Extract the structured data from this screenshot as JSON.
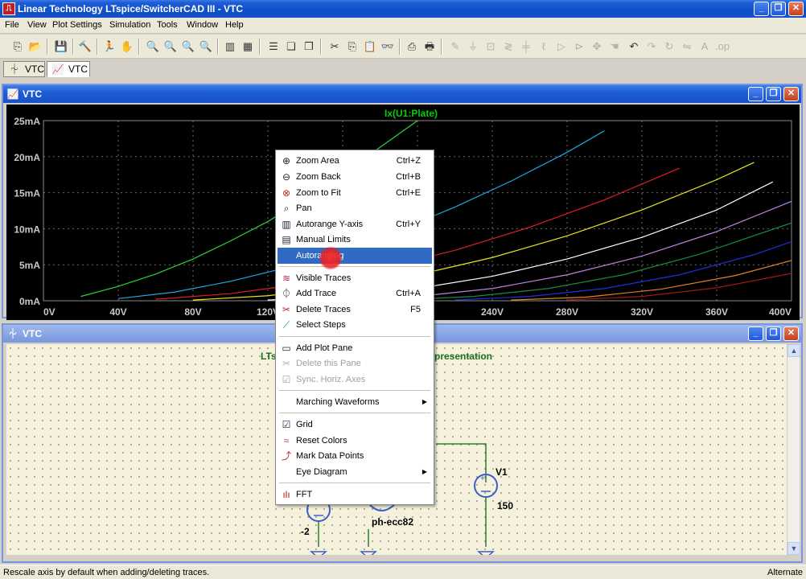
{
  "window": {
    "title": "Linear Technology LTspice/SwitcherCAD III - VTC",
    "app_icon": "ltspice-logo-icon"
  },
  "menubar": [
    "File",
    "View",
    "Plot Settings",
    "Simulation",
    "Tools",
    "Window",
    "Help"
  ],
  "tabs": [
    {
      "label": "VTC",
      "icon": "schematic-icon"
    },
    {
      "label": "VTC",
      "icon": "waveform-icon"
    }
  ],
  "plot_window": {
    "title": "VTC",
    "trace_title": "Ix(U1:Plate)"
  },
  "chart_data": {
    "type": "line",
    "title": "Ix(U1:Plate)",
    "xlabel": "",
    "ylabel": "",
    "x_ticks": [
      "0V",
      "40V",
      "80V",
      "120V",
      "160V",
      "200V",
      "240V",
      "280V",
      "320V",
      "360V",
      "400V"
    ],
    "y_ticks": [
      "0mA",
      "5mA",
      "10mA",
      "15mA",
      "20mA",
      "25mA"
    ],
    "xlim": [
      0,
      400
    ],
    "ylim": [
      0,
      25
    ],
    "grid": true,
    "background": "#000000",
    "series": [
      {
        "color": "#2cd23c",
        "x": [
          20,
          40,
          60,
          80,
          100,
          120,
          140,
          160,
          180,
          200,
          220
        ],
        "y": [
          0.6,
          2.0,
          3.7,
          5.8,
          8.3,
          11.0,
          14.2,
          17.6,
          21.3,
          25.0,
          28.0
        ]
      },
      {
        "color": "#1ea8e0",
        "x": [
          40,
          70,
          100,
          130,
          160,
          190,
          220,
          250,
          280,
          300
        ],
        "y": [
          0.3,
          1.2,
          2.7,
          4.6,
          7.0,
          9.8,
          13.0,
          16.6,
          20.6,
          23.6
        ]
      },
      {
        "color": "#e02020",
        "x": [
          60,
          100,
          140,
          180,
          220,
          260,
          300,
          340
        ],
        "y": [
          0.2,
          1.0,
          2.4,
          4.4,
          7.0,
          10.2,
          14.0,
          18.4
        ]
      },
      {
        "color": "#e6e620",
        "x": [
          80,
          120,
          160,
          200,
          240,
          280,
          320,
          360,
          380
        ],
        "y": [
          0.1,
          0.7,
          1.9,
          3.6,
          6.0,
          9.0,
          12.6,
          16.8,
          19.2
        ]
      },
      {
        "color": "#ffffff",
        "x": [
          120,
          160,
          200,
          240,
          280,
          320,
          360,
          390
        ],
        "y": [
          0.1,
          0.6,
          1.7,
          3.4,
          5.8,
          8.8,
          12.6,
          16.5
        ]
      },
      {
        "color": "#c080e0",
        "x": [
          160,
          200,
          240,
          280,
          320,
          360,
          400
        ],
        "y": [
          0.1,
          0.6,
          1.7,
          3.6,
          6.2,
          9.6,
          13.8
        ]
      },
      {
        "color": "#1c8a3c",
        "x": [
          190,
          230,
          270,
          310,
          350,
          400
        ],
        "y": [
          0.1,
          0.6,
          1.7,
          3.6,
          6.4,
          10.8
        ]
      },
      {
        "color": "#2030e0",
        "x": [
          220,
          260,
          300,
          340,
          380,
          400
        ],
        "y": [
          0.1,
          0.6,
          1.7,
          3.6,
          6.4,
          8.2
        ]
      },
      {
        "color": "#e08020",
        "x": [
          250,
          290,
          330,
          370,
          400
        ],
        "y": [
          0.1,
          0.5,
          1.6,
          3.5,
          5.6
        ]
      },
      {
        "color": "#a01818",
        "x": [
          280,
          320,
          360,
          400
        ],
        "y": [
          0.1,
          0.6,
          1.8,
          3.8
        ]
      }
    ]
  },
  "schematic_window": {
    "title": "VTC",
    "text_left": "LTs",
    "text_right": "presentation",
    "labels": {
      "v1": "V1",
      "v1_value": "150",
      "v2_value": "-2",
      "tube": "ph-ecc82"
    }
  },
  "context_menu": {
    "items": [
      {
        "label": "Zoom Area",
        "shortcut": "Ctrl+Z",
        "icon": "zoom-area-icon"
      },
      {
        "label": "Zoom Back",
        "shortcut": "Ctrl+B",
        "icon": "zoom-back-icon"
      },
      {
        "label": "Zoom to Fit",
        "shortcut": "Ctrl+E",
        "icon": "zoom-fit-icon"
      },
      {
        "label": "Pan",
        "shortcut": "",
        "icon": "pan-icon"
      },
      {
        "label": "Autorange Y-axis",
        "shortcut": "Ctrl+Y",
        "icon": "autorange-icon"
      },
      {
        "label": "Manual Limits",
        "shortcut": "",
        "icon": "manual-limits-icon"
      },
      {
        "label": "Autoranging",
        "shortcut": "",
        "icon": ""
      },
      {
        "label": "Visible Traces",
        "shortcut": "",
        "icon": "visible-traces-icon"
      },
      {
        "label": "Add Trace",
        "shortcut": "Ctrl+A",
        "icon": "add-trace-icon"
      },
      {
        "label": "Delete Traces",
        "shortcut": "F5",
        "icon": "scissors-icon"
      },
      {
        "label": "Select Steps",
        "shortcut": "",
        "icon": "select-steps-icon"
      },
      {
        "label": "Add Plot Pane",
        "shortcut": "",
        "icon": "add-pane-icon"
      },
      {
        "label": "Delete this Pane",
        "shortcut": "",
        "icon": "delete-pane-icon"
      },
      {
        "label": "Sync. Horiz. Axes",
        "shortcut": "",
        "icon": "checkbox-icon"
      },
      {
        "label": "Marching Waveforms",
        "shortcut": "",
        "icon": ""
      },
      {
        "label": "Grid",
        "shortcut": "",
        "icon": "checkbox-icon"
      },
      {
        "label": "Reset Colors",
        "shortcut": "",
        "icon": "reset-colors-icon"
      },
      {
        "label": "Mark Data Points",
        "shortcut": "",
        "icon": "mark-points-icon"
      },
      {
        "label": "Eye Diagram",
        "shortcut": "",
        "icon": ""
      },
      {
        "label": "FFT",
        "shortcut": "",
        "icon": "fft-icon"
      }
    ]
  },
  "statusbar": {
    "left": "Rescale axis by default when adding/deleting traces.",
    "right": "Alternate"
  }
}
